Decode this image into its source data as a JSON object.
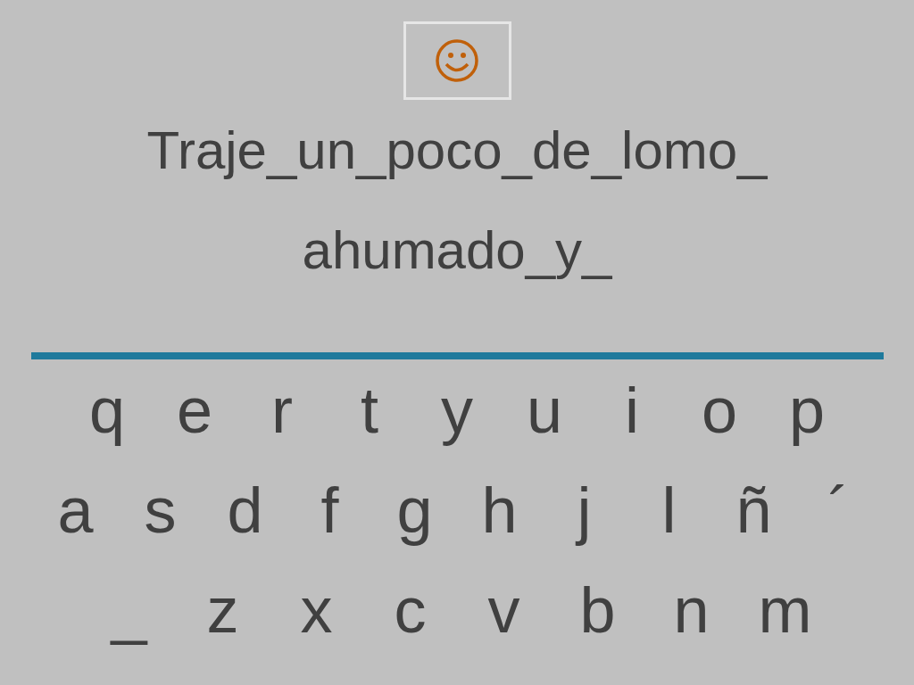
{
  "sentence_lines": [
    "Traje_un_poco_de_lomo_",
    "ahumado_y_"
  ],
  "keyboard": {
    "rows": [
      {
        "keys": [
          "q",
          "e",
          "r",
          "t",
          "y",
          "u",
          "i",
          "o",
          "p"
        ]
      },
      {
        "keys": [
          "a",
          "s",
          "d",
          "f",
          "g",
          "h",
          "j",
          "l",
          "ñ",
          "´"
        ]
      },
      {
        "keys": [
          "_",
          "z",
          "x",
          "c",
          "v",
          "b",
          "n",
          "m"
        ]
      }
    ]
  }
}
